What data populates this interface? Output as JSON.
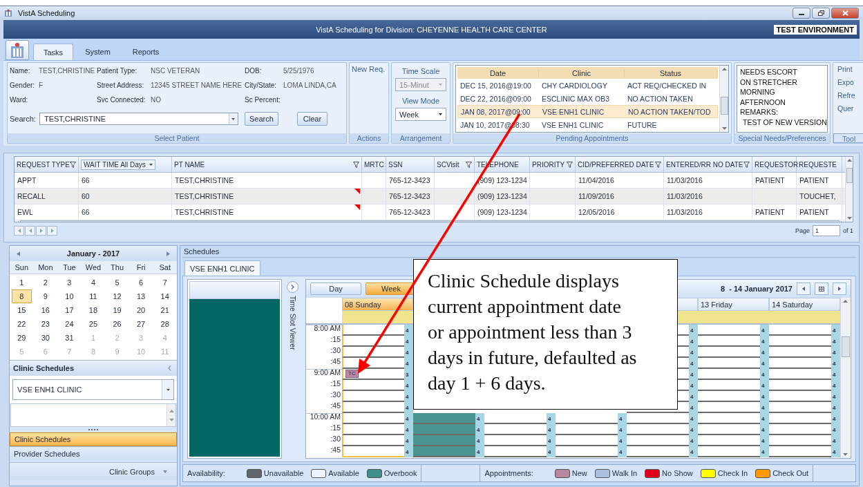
{
  "window": {
    "title": "VistA Scheduling"
  },
  "banner": {
    "title": "VistA Scheduling for Division: CHEYENNE HEALTH CARE CENTER",
    "environment": "TEST ENVIRONMENT"
  },
  "ribbon_tabs": [
    {
      "label": "Tasks",
      "selected": true
    },
    {
      "label": "System",
      "selected": false
    },
    {
      "label": "Reports",
      "selected": false
    }
  ],
  "select_patient": {
    "label": "Select Patient",
    "fields": [
      {
        "label": "Name:",
        "value": "TEST,CHRISTINE"
      },
      {
        "label": "Patient Type:",
        "value": "NSC VETERAN"
      },
      {
        "label": "DOB:",
        "value": "5/25/1976"
      },
      {
        "label": "Gender:",
        "value": "F"
      },
      {
        "label": "Street Address:",
        "value": "12345 STREET NAME HERE"
      },
      {
        "label": "City/State:",
        "value": "LOMA LINDA,CA"
      },
      {
        "label": "Ward:"
      },
      {
        "label": "Svc Connected:",
        "value": "NO"
      },
      {
        "label": "Sc Percent:"
      }
    ],
    "search": {
      "label": "Search:",
      "value": "TEST,CHRISTINE"
    },
    "buttons": [
      "Search",
      "Clear"
    ]
  },
  "actions": {
    "label": "Actions",
    "buttons": [
      "New Req."
    ]
  },
  "arrangement": {
    "label": "Arrangement",
    "time_scale": {
      "label": "Time Scale",
      "value": "15-Minut",
      "disabled": true
    },
    "view_mode": {
      "label": "View Mode",
      "value": "Week",
      "disabled": false
    }
  },
  "pending_appointments": {
    "label": "Pending Appointments",
    "columns": [
      "Date",
      "Clinic",
      "Status"
    ],
    "rows": [
      {
        "cells": [
          "DEC 15, 2016@19:00",
          "CHY CARDIOLOGY",
          "ACT REQ/CHECKED IN"
        ],
        "selected": false
      },
      {
        "cells": [
          "DEC 22, 2016@09:00",
          "ESCLINIC MAX OB3",
          "NO ACTION TAKEN"
        ],
        "selected": false
      },
      {
        "cells": [
          "JAN 08, 2017@09:00",
          "VSE ENH1 CLINIC",
          "NO ACTION TAKEN/TOD"
        ],
        "selected": true
      },
      {
        "cells": [
          "JAN 10, 2017@08:30",
          "VSE ENH1 CLINIC",
          "FUTURE"
        ],
        "selected": false
      }
    ]
  },
  "special_needs": {
    "label": "Special Needs/Preferences",
    "lines": [
      {
        "text": "NEEDS ESCORT",
        "indented": false
      },
      {
        "text": "ON STRETCHER",
        "indented": false
      },
      {
        "text": "MORNING",
        "indented": false
      },
      {
        "text": "AFTERNOON",
        "indented": false
      },
      {
        "text": "REMARKS:",
        "indented": false
      },
      {
        "text": "TEST OF NEW VERSION",
        "indented": true
      }
    ]
  },
  "tools": {
    "label": "Tool",
    "items": [
      "Print",
      "Expo",
      "Refre",
      "Quer"
    ]
  },
  "requests": {
    "columns": [
      {
        "label": "REQUEST TYPE",
        "kind": "filter"
      },
      {
        "label": "WAIT TIME All Days",
        "kind": "dropdown"
      },
      {
        "label": "PT NAME",
        "kind": "filter"
      },
      {
        "label": "MRTC",
        "kind": "plain"
      },
      {
        "label": "SSN",
        "kind": "plain"
      },
      {
        "label": "SCVisit",
        "kind": "filter"
      },
      {
        "label": "TELEPHONE",
        "kind": "plain"
      },
      {
        "label": "PRIORITY",
        "kind": "filter"
      },
      {
        "label": "CID/PREFERRED DATE",
        "kind": "filter"
      },
      {
        "label": "ENTERED/RR NO DATE",
        "kind": "filter"
      },
      {
        "label": "REQUESTOR",
        "kind": "plain"
      },
      {
        "label": "REQUESTE",
        "kind": "plain"
      }
    ],
    "rows": [
      {
        "cells": [
          "APPT",
          "66",
          "TEST,CHRISTINE",
          null,
          "765-12-3423",
          null,
          "(909) 123-1234",
          null,
          "11/04/2016",
          "11/03/2016",
          "PATIENT",
          "PATIENT"
        ],
        "flagged": false
      },
      {
        "cells": [
          "RECALL",
          "60",
          "TEST,CHRISTINE",
          null,
          "765-12-3423",
          null,
          "(909) 123-1234",
          null,
          "11/09/2016",
          "11/03/2016",
          null,
          "TOUCHET,"
        ],
        "flagged": true
      },
      {
        "cells": [
          "EWL",
          "66",
          "TEST,CHRISTINE",
          null,
          "765-12-3423",
          null,
          "(909) 123-1234",
          null,
          "12/05/2016",
          "11/03/2016",
          "PATIENT",
          "PATIENT"
        ],
        "flagged": true
      }
    ],
    "pager": {
      "label": "Page",
      "value": "1",
      "total": "of 1"
    }
  },
  "calendar": {
    "title": "January - 2017",
    "weekdays": [
      "Sun",
      "Mon",
      "Tue",
      "Wed",
      "Thu",
      "Fri",
      "Sat"
    ],
    "weeks": [
      [
        {
          "label": "1",
          "other_month": false,
          "selected": false
        },
        {
          "label": "2",
          "other_month": false,
          "selected": false
        },
        {
          "label": "3",
          "other_month": false,
          "selected": false
        },
        {
          "label": "4",
          "other_month": false,
          "selected": false
        },
        {
          "label": "5",
          "other_month": false,
          "selected": false
        },
        {
          "label": "6",
          "other_month": false,
          "selected": false
        },
        {
          "label": "7",
          "other_month": false,
          "selected": false
        }
      ],
      [
        {
          "label": "8",
          "other_month": false,
          "selected": true
        },
        {
          "label": "9",
          "other_month": false,
          "selected": false
        },
        {
          "label": "10",
          "other_month": false,
          "selected": false
        },
        {
          "label": "11",
          "other_month": false,
          "selected": false
        },
        {
          "label": "12",
          "other_month": false,
          "selected": false
        },
        {
          "label": "13",
          "other_month": false,
          "selected": false
        },
        {
          "label": "14",
          "other_month": false,
          "selected": false
        }
      ],
      [
        {
          "label": "15",
          "other_month": false,
          "selected": false
        },
        {
          "label": "16",
          "other_month": false,
          "selected": false
        },
        {
          "label": "17",
          "other_month": false,
          "selected": false
        },
        {
          "label": "18",
          "other_month": false,
          "selected": false
        },
        {
          "label": "19",
          "other_month": false,
          "selected": false
        },
        {
          "label": "20",
          "other_month": false,
          "selected": false
        },
        {
          "label": "21",
          "other_month": false,
          "selected": false
        }
      ],
      [
        {
          "label": "22",
          "other_month": false,
          "selected": false
        },
        {
          "label": "23",
          "other_month": false,
          "selected": false
        },
        {
          "label": "24",
          "other_month": false,
          "selected": false
        },
        {
          "label": "25",
          "other_month": false,
          "selected": false
        },
        {
          "label": "26",
          "other_month": false,
          "selected": false
        },
        {
          "label": "27",
          "other_month": false,
          "selected": false
        },
        {
          "label": "28",
          "other_month": false,
          "selected": false
        }
      ],
      [
        {
          "label": "29",
          "other_month": false,
          "selected": false
        },
        {
          "label": "30",
          "other_month": false,
          "selected": false
        },
        {
          "label": "31",
          "other_month": false,
          "selected": false
        },
        {
          "label": "1",
          "other_month": true,
          "selected": false
        },
        {
          "label": "2",
          "other_month": true,
          "selected": false
        },
        {
          "label": "3",
          "other_month": true,
          "selected": false
        },
        {
          "label": "4",
          "other_month": true,
          "selected": false
        }
      ],
      [
        {
          "label": "5",
          "other_month": true,
          "selected": false
        },
        {
          "label": "6",
          "other_month": true,
          "selected": false
        },
        {
          "label": "7",
          "other_month": true,
          "selected": false
        },
        {
          "label": "8",
          "other_month": true,
          "selected": false
        },
        {
          "label": "9",
          "other_month": true,
          "selected": false
        },
        {
          "label": "10",
          "other_month": true,
          "selected": false
        },
        {
          "label": "11",
          "other_month": true,
          "selected": false
        }
      ]
    ]
  },
  "clinic_schedules": {
    "title": "Clinic Schedules",
    "selected_clinic": "VSE ENH1 CLINIC"
  },
  "navigation": [
    {
      "label": "Clinic Schedules",
      "selected": true,
      "kind": "item"
    },
    {
      "label": "Provider Schedules",
      "selected": false,
      "kind": "item"
    },
    {
      "label": "Clinic Groups",
      "selected": false,
      "kind": "menu"
    }
  ],
  "schedules": {
    "title": "Schedules",
    "tabs": [
      {
        "label": "VSE ENH1 CLINIC",
        "selected": true
      }
    ],
    "time_slot_viewer": "Time Slot Viewer",
    "view_buttons": [
      {
        "label": "Day",
        "selected": false
      },
      {
        "label": "Week",
        "selected": true
      }
    ],
    "range": "8  - 14 January 2017",
    "time_rows": [
      "8:00 AM",
      ":15",
      ":30",
      ":45",
      "9:00 AM",
      ":15",
      ":30",
      ":45",
      "10:00 AM",
      ":15",
      ":30",
      ":45"
    ],
    "days": [
      {
        "header": "08 Sunday",
        "selected": true,
        "kind": "available",
        "slots": [
          {
            "count": "4"
          },
          {
            "count": "4"
          },
          {
            "count": "4"
          },
          {
            "count": "4"
          },
          {
            "count": "3",
            "appointment": {
              "label": "TC",
              "color": "#b986a3"
            }
          },
          {
            "count": "4"
          },
          {
            "count": "4"
          },
          {
            "count": "4"
          },
          {
            "count": "4"
          },
          {
            "count": "4"
          },
          {
            "count": "4"
          },
          {
            "count": "4"
          }
        ]
      },
      {
        "selected": false,
        "kind": "overbook",
        "slots": [
          {
            "count": "4"
          },
          {
            "count": "4"
          },
          {
            "count": "4"
          },
          {
            "count": "4"
          }
        ]
      },
      {
        "selected": false,
        "kind": "available",
        "slots": [
          {
            "count": "4"
          },
          {
            "count": "4"
          },
          {
            "count": "4"
          },
          {
            "count": "4"
          }
        ]
      },
      {
        "selected": false,
        "kind": "available",
        "slots": [
          {
            "count": "4"
          },
          {
            "count": "4"
          },
          {
            "count": "4"
          },
          {
            "count": "4"
          }
        ]
      },
      {
        "selected": false,
        "kind": "available",
        "slots": [
          {
            "count": "4"
          },
          {
            "count": "4"
          },
          {
            "count": "4"
          },
          {
            "count": "4"
          },
          {
            "count": "4"
          },
          {
            "count": "4"
          },
          {
            "count": "4"
          },
          {
            "count": "4"
          },
          {
            "count": "4"
          },
          {
            "count": "4"
          },
          {
            "count": "4"
          },
          {
            "count": "4"
          }
        ]
      },
      {
        "header": "13 Friday",
        "selected": false,
        "kind": "available",
        "slots": [
          {
            "count": "4"
          },
          {
            "count": "4"
          },
          {
            "count": "4"
          },
          {
            "count": "4"
          },
          {
            "count": "4"
          },
          {
            "count": "4"
          },
          {
            "count": "4"
          },
          {
            "count": "4"
          },
          {
            "count": "4"
          },
          {
            "count": "4"
          },
          {
            "count": "4"
          },
          {
            "count": "4"
          }
        ]
      },
      {
        "header": "14 Saturday",
        "selected": false,
        "kind": "available",
        "slots": [
          {
            "count": "4"
          },
          {
            "count": "4"
          },
          {
            "count": "4"
          },
          {
            "count": "4"
          },
          {
            "count": "4"
          },
          {
            "count": "4"
          },
          {
            "count": "4"
          },
          {
            "count": "4"
          },
          {
            "count": "4"
          },
          {
            "count": "4"
          },
          {
            "count": "4"
          },
          {
            "count": "4"
          }
        ]
      }
    ],
    "legend": {
      "availability_label": "Availability:",
      "availability": [
        {
          "label": "Unavailable",
          "color": "#5f6670"
        },
        {
          "label": "Available",
          "color": "#eef4fc"
        },
        {
          "label": "Overbook",
          "color": "#3f8f8c"
        }
      ],
      "appointments_label": "Appointments:",
      "appointments": [
        {
          "label": "New",
          "color": "#b986a3"
        },
        {
          "label": "Walk In",
          "color": "#a8c0dc"
        },
        {
          "label": "No Show",
          "color": "#e0001b"
        },
        {
          "label": "Check In",
          "color": "#ffff00"
        },
        {
          "label": "Check Out",
          "color": "#ff9900"
        }
      ]
    }
  },
  "annotation": {
    "text": "Clinic Schedule displays current appointment date or appointment less than 3 days in future, defaulted as day 1 + 6 days."
  }
}
